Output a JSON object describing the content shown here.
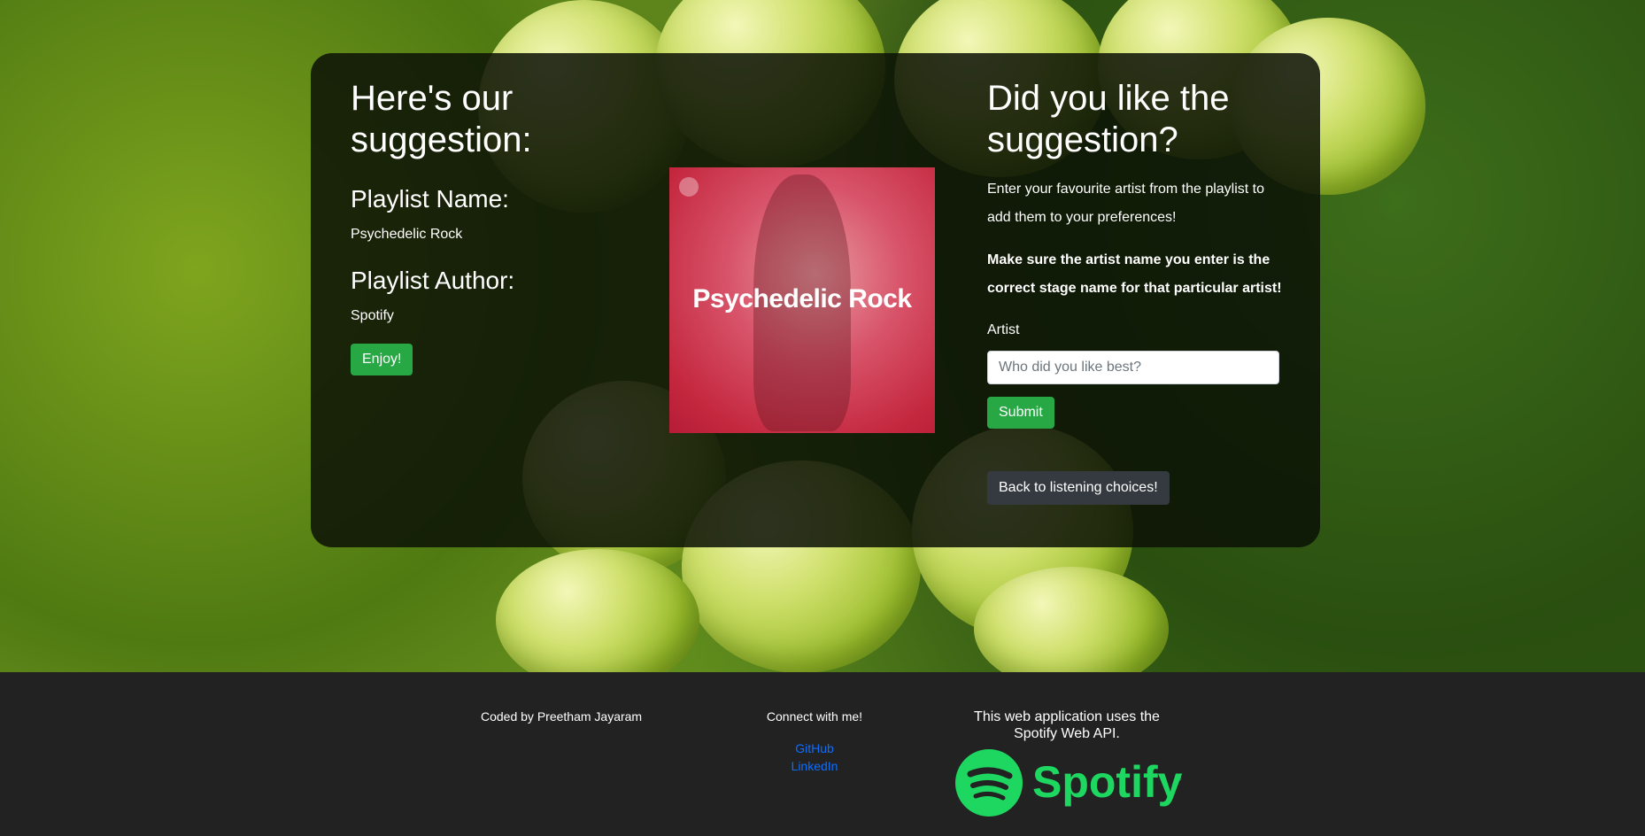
{
  "suggestion": {
    "heading": "Here's our suggestion:",
    "name_label": "Playlist Name:",
    "name_value": "Psychedelic Rock",
    "author_label": "Playlist Author:",
    "author_value": "Spotify",
    "enjoy_button": "Enjoy!"
  },
  "cover": {
    "title": "Psychedelic Rock"
  },
  "feedback": {
    "heading": "Did you like the suggestion?",
    "intro": "Enter your favourite artist from the playlist to add them to your preferences!",
    "warning": "Make sure the artist name you enter is the correct stage name for that particular artist!",
    "artist_label": "Artist",
    "artist_placeholder": "Who did you like best?",
    "submit_button": "Submit",
    "back_button": "Back to listening choices!"
  },
  "footer": {
    "credit": "Coded by Preetham Jayaram",
    "connect_heading": "Connect with me!",
    "github_link": "GitHub",
    "linkedin_link": "LinkedIn",
    "api_note": "This web application uses the Spotify Web API.",
    "spotify_wordmark": "Spotify"
  },
  "colors": {
    "accent_green": "#28a745",
    "spotify_green": "#1ed760",
    "footer_bg": "#222222",
    "link_blue": "#0d6efd"
  }
}
